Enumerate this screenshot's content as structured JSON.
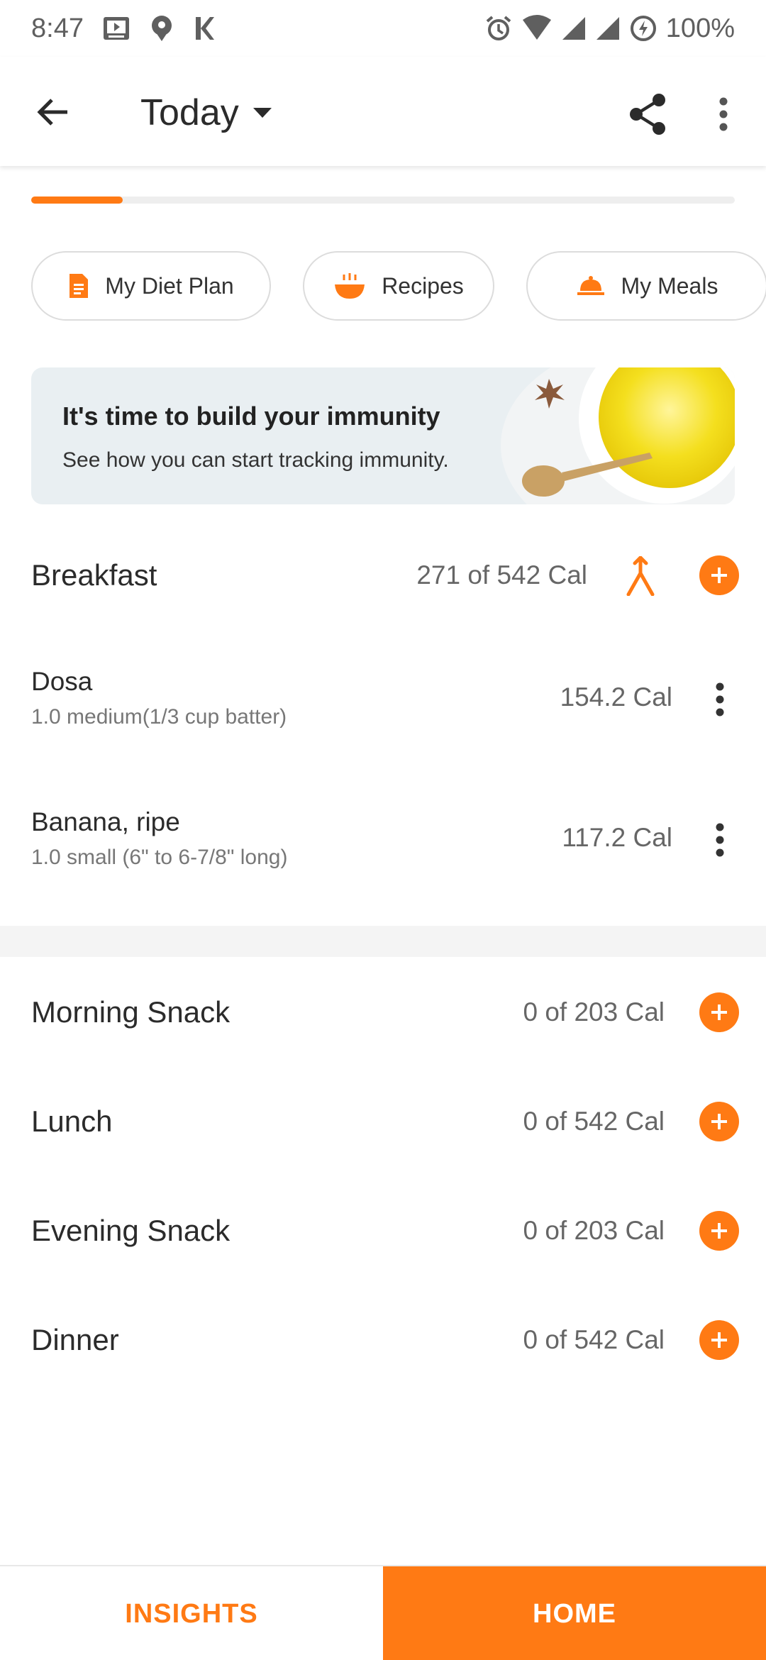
{
  "status_bar": {
    "time": "8:47",
    "battery": "100%",
    "icons_left": [
      "video-icon",
      "location-icon",
      "k-app-icon"
    ],
    "icons_right": [
      "alarm-icon",
      "wifi-icon",
      "signal-icon",
      "signal-icon",
      "battery-icon"
    ]
  },
  "app_bar": {
    "title": "Today",
    "icons": [
      "back-arrow-icon",
      "caret-down-icon",
      "share-icon",
      "more-vert-icon"
    ]
  },
  "progress": {
    "value": 0.13
  },
  "chips": [
    {
      "label": "My Diet Plan",
      "icon": "document-icon"
    },
    {
      "label": "Recipes",
      "icon": "bowl-icon"
    },
    {
      "label": "My Meals",
      "icon": "cloche-icon"
    }
  ],
  "banner": {
    "title": "It's time to build your immunity",
    "subtitle": "See how you can start tracking immunity."
  },
  "meals": {
    "breakfast": {
      "name": "Breakfast",
      "cal": "271 of 542 Cal",
      "items": [
        {
          "name": "Dosa",
          "qty": "1.0 medium(1/3 cup batter)",
          "cal": "154.2 Cal"
        },
        {
          "name": "Banana, ripe",
          "qty": "1.0 small (6\" to 6-7/8\" long)",
          "cal": "117.2 Cal"
        }
      ]
    },
    "morning_snack": {
      "name": "Morning Snack",
      "cal": "0 of 203 Cal"
    },
    "lunch": {
      "name": "Lunch",
      "cal": "0 of 542 Cal"
    },
    "evening_snack": {
      "name": "Evening Snack",
      "cal": "0 of 203 Cal"
    },
    "dinner": {
      "name": "Dinner",
      "cal": "0 of 542 Cal"
    }
  },
  "bottom_nav": {
    "insights": "INSIGHTS",
    "home": "HOME",
    "active": "home"
  },
  "colors": {
    "accent": "#ff7a14",
    "banner_bg": "#e9eff2"
  }
}
